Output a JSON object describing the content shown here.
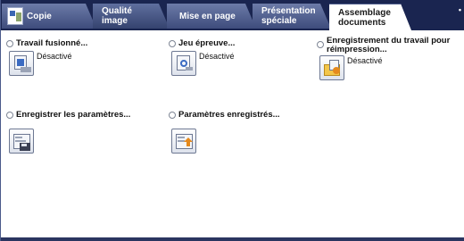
{
  "tabs": [
    {
      "id": "copie",
      "label": "Copie"
    },
    {
      "id": "qualite",
      "label": "Qualité image"
    },
    {
      "id": "mise",
      "label": "Mise en page"
    },
    {
      "id": "presentation",
      "label": "Présentation spéciale"
    },
    {
      "id": "assemblage",
      "label": "Assemblage documents",
      "selected": true
    }
  ],
  "overflow": "•",
  "options": {
    "travail": {
      "label": "Travail fusionné...",
      "status": "Désactivé"
    },
    "jeu": {
      "label": "Jeu épreuve...",
      "status": "Désactivé"
    },
    "enregistrement": {
      "label": "Enregistrement du travail pour réimpression...",
      "status": "Désactivé"
    },
    "enregistrer_params": {
      "label": "Enregistrer les paramètres..."
    },
    "params_enregistres": {
      "label": "Paramètres enregistrés..."
    }
  },
  "colors": {
    "tabbar": "#1a2550",
    "tab": "#5f6f9e",
    "selected_tab": "#ffffff",
    "accent": "#3b6bc2"
  }
}
